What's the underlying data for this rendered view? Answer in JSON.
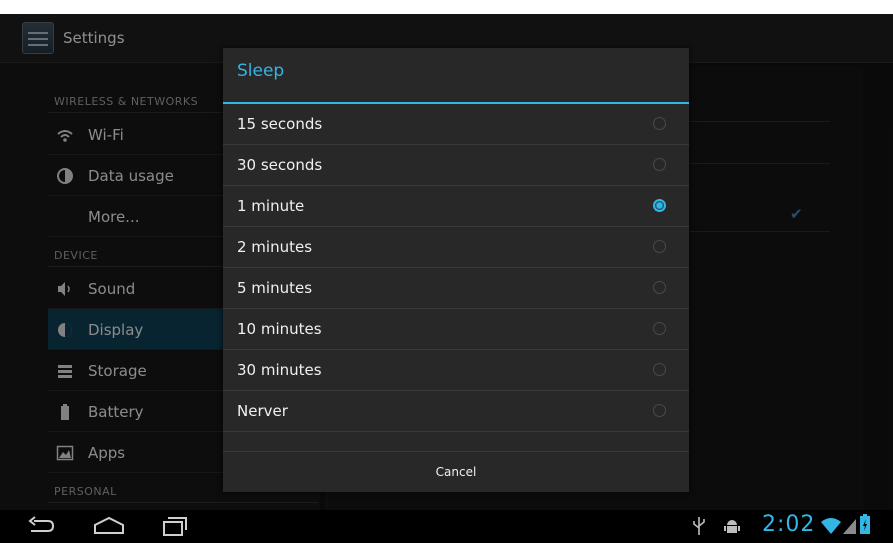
{
  "app": {
    "title": "Settings",
    "icon": "settings-app-icon"
  },
  "sidebar": {
    "sections": [
      {
        "header": "WIRELESS & NETWORKS"
      },
      {
        "header": "DEVICE"
      },
      {
        "header": "PERSONAL"
      }
    ],
    "items": [
      {
        "label": "Wi-Fi",
        "icon": "wifi-icon"
      },
      {
        "label": "Data usage",
        "icon": "data-usage-icon"
      },
      {
        "label": "More...",
        "icon": ""
      },
      {
        "label": "Sound",
        "icon": "speaker-icon"
      },
      {
        "label": "Display",
        "icon": "brightness-icon",
        "selected": true
      },
      {
        "label": "Storage",
        "icon": "storage-icon"
      },
      {
        "label": "Battery",
        "icon": "battery-icon"
      },
      {
        "label": "Apps",
        "icon": "apps-icon"
      }
    ]
  },
  "dialog": {
    "title": "Sleep",
    "options": [
      {
        "label": "15 seconds",
        "selected": false
      },
      {
        "label": "30 seconds",
        "selected": false
      },
      {
        "label": "1 minute",
        "selected": true
      },
      {
        "label": "2 minutes",
        "selected": false
      },
      {
        "label": "5 minutes",
        "selected": false
      },
      {
        "label": "10 minutes",
        "selected": false
      },
      {
        "label": "30 minutes",
        "selected": false
      },
      {
        "label": "Nerver",
        "selected": false
      }
    ],
    "cancel_label": "Cancel"
  },
  "status_bar": {
    "time": "2:02"
  },
  "colors": {
    "accent": "#33b5e5",
    "selected_item": "#0e3a4f",
    "background": "#111111"
  }
}
